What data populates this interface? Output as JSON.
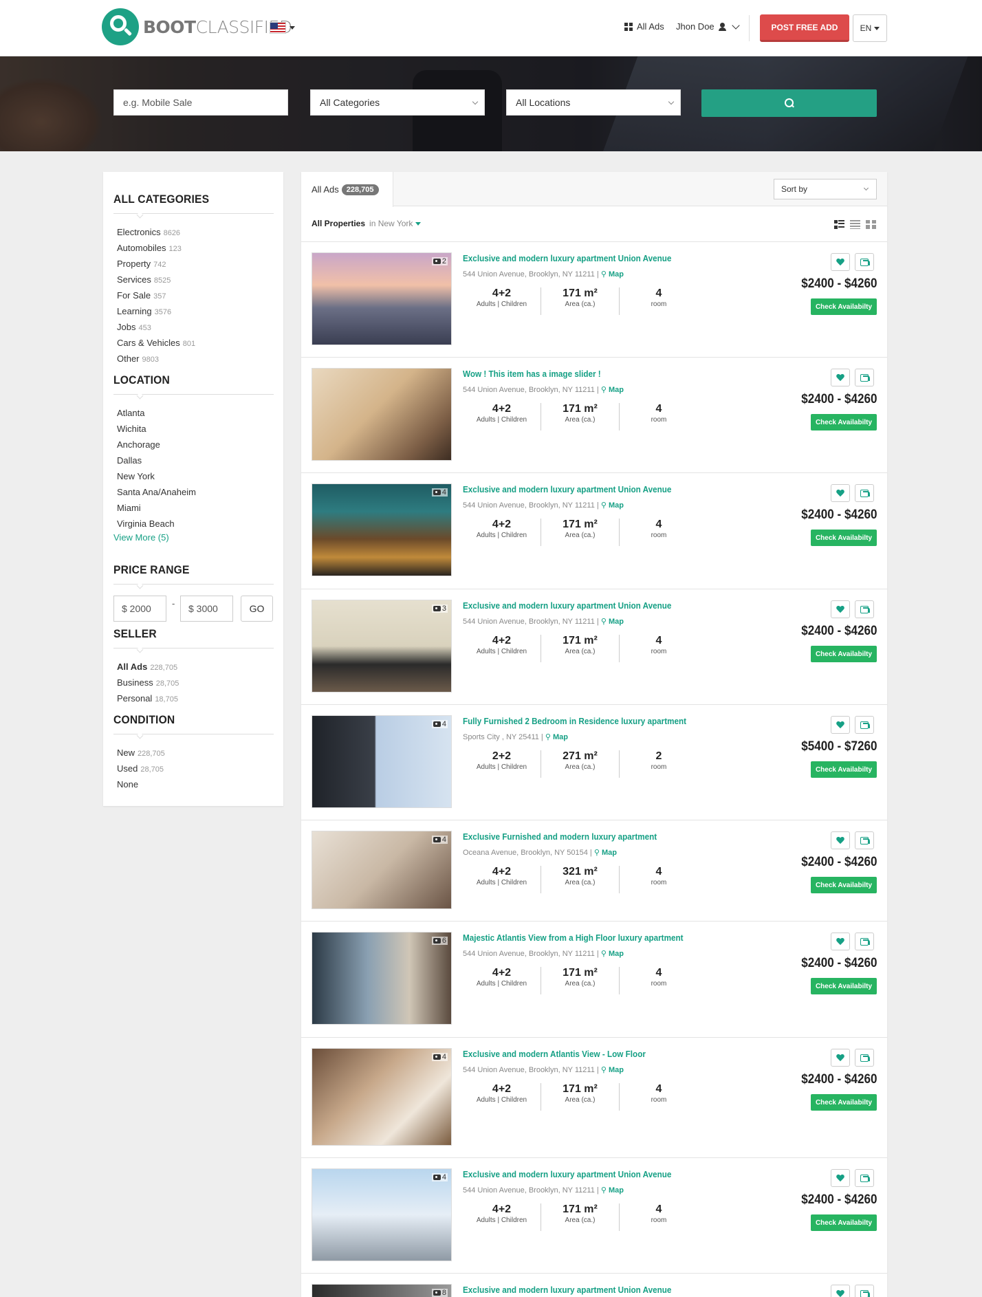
{
  "header": {
    "logo_bold": "BOOT",
    "logo_light": "CLASSIFIED",
    "all_ads": "All Ads",
    "user": "Jhon Doe",
    "post_button": "POST FREE ADD",
    "lang": "EN"
  },
  "search": {
    "keyword_placeholder": "e.g. Mobile Sale",
    "category": "All Categories",
    "location": "All Locations"
  },
  "sidebar": {
    "categories_title": "ALL CATEGORIES",
    "categories": [
      {
        "label": "Electronics",
        "count": "8626"
      },
      {
        "label": "Automobiles",
        "count": "123"
      },
      {
        "label": "Property",
        "count": "742"
      },
      {
        "label": "Services",
        "count": "8525"
      },
      {
        "label": "For Sale",
        "count": "357"
      },
      {
        "label": "Learning",
        "count": "3576"
      },
      {
        "label": "Jobs",
        "count": "453"
      },
      {
        "label": "Cars & Vehicles",
        "count": "801"
      },
      {
        "label": "Other",
        "count": "9803"
      }
    ],
    "location_title": "LOCATION",
    "locations": [
      "Atlanta",
      "Wichita",
      "Anchorage",
      "Dallas",
      "New York",
      "Santa Ana/Anaheim",
      "Miami",
      "Virginia Beach"
    ],
    "view_more": "View More (5)",
    "price_title": "PRICE RANGE",
    "price_min": "$ 2000",
    "price_sep": "-",
    "price_max": "$ 3000",
    "go": "GO",
    "seller_title": "SELLER",
    "sellers": [
      {
        "label": "All Ads",
        "count": "228,705"
      },
      {
        "label": "Business",
        "count": "28,705"
      },
      {
        "label": "Personal",
        "count": "18,705"
      }
    ],
    "condition_title": "CONDITION",
    "conditions": [
      {
        "label": "New",
        "count": "228,705"
      },
      {
        "label": "Used",
        "count": "28,705"
      },
      {
        "label": "None",
        "count": ""
      }
    ]
  },
  "listing": {
    "tab_label": "All Ads",
    "tab_count": "228,705",
    "sort_label": "Sort by",
    "filter_bold": "All Properties",
    "filter_loc": "in New York",
    "check_label": "Check Availabilty",
    "map_label": "Map",
    "items": [
      {
        "title": "Exclusive and modern luxury apartment Union Avenue",
        "address": "544 Union Avenue, Brooklyn, NY 11211 |",
        "photos": "2",
        "guests": "4+2",
        "guests_label": "Adults | Children",
        "area": "171 m²",
        "area_label": "Area (ca.)",
        "rooms": "4",
        "rooms_label": "room",
        "price": "$2400 - $4260"
      },
      {
        "title": "Wow ! This item has a image slider !",
        "address": "544 Union Avenue, Brooklyn, NY 11211 |",
        "photos": "",
        "guests": "4+2",
        "guests_label": "Adults | Children",
        "area": "171 m²",
        "area_label": "Area (ca.)",
        "rooms": "4",
        "rooms_label": "room",
        "price": "$2400 - $4260"
      },
      {
        "title": "Exclusive and modern luxury apartment Union Avenue",
        "address": "544 Union Avenue, Brooklyn, NY 11211 |",
        "photos": "4",
        "guests": "4+2",
        "guests_label": "Adults | Children",
        "area": "171 m²",
        "area_label": "Area (ca.)",
        "rooms": "4",
        "rooms_label": "room",
        "price": "$2400 - $4260"
      },
      {
        "title": "Exclusive and modern luxury apartment Union Avenue",
        "address": "544 Union Avenue, Brooklyn, NY 11211 |",
        "photos": "3",
        "guests": "4+2",
        "guests_label": "Adults | Children",
        "area": "171 m²",
        "area_label": "Area (ca.)",
        "rooms": "4",
        "rooms_label": "room",
        "price": "$2400 - $4260"
      },
      {
        "title": "Fully Furnished 2 Bedroom in Residence luxury apartment",
        "address": "Sports City , NY 25411 |",
        "photos": "4",
        "guests": "2+2",
        "guests_label": "Adults | Children",
        "area": "271 m²",
        "area_label": "Area (ca.)",
        "rooms": "2",
        "rooms_label": "room",
        "price": "$5400 - $7260"
      },
      {
        "title": "Exclusive Furnished and modern luxury apartment",
        "address": "Oceana Avenue, Brooklyn, NY 50154 |",
        "photos": "4",
        "guests": "4+2",
        "guests_label": "Adults | Children",
        "area": "321 m²",
        "area_label": "Area (ca.)",
        "rooms": "4",
        "rooms_label": "room",
        "price": "$2400 - $4260"
      },
      {
        "title": "Majestic Atlantis View from a High Floor luxury apartment",
        "address": "544 Union Avenue, Brooklyn, NY 11211 |",
        "photos": "6",
        "guests": "4+2",
        "guests_label": "Adults | Children",
        "area": "171 m²",
        "area_label": "Area (ca.)",
        "rooms": "4",
        "rooms_label": "room",
        "price": "$2400 - $4260"
      },
      {
        "title": "Exclusive and modern Atlantis View - Low Floor",
        "address": "544 Union Avenue, Brooklyn, NY 11211 |",
        "photos": "4",
        "guests": "4+2",
        "guests_label": "Adults | Children",
        "area": "171 m²",
        "area_label": "Area (ca.)",
        "rooms": "4",
        "rooms_label": "room",
        "price": "$2400 - $4260"
      },
      {
        "title": "Exclusive and modern luxury apartment Union Avenue",
        "address": "544 Union Avenue, Brooklyn, NY 11211 |",
        "photos": "4",
        "guests": "4+2",
        "guests_label": "Adults | Children",
        "area": "171 m²",
        "area_label": "Area (ca.)",
        "rooms": "4",
        "rooms_label": "room",
        "price": "$2400 - $4260"
      },
      {
        "title": "Exclusive and modern luxury apartment Union Avenue",
        "address": "",
        "photos": "8",
        "guests": "",
        "guests_label": "",
        "area": "",
        "area_label": "",
        "rooms": "",
        "rooms_label": "",
        "price": ""
      }
    ]
  },
  "colors": {
    "accent": "#16a085",
    "post_button": "#dd4b4b",
    "check_button": "#27b461"
  }
}
